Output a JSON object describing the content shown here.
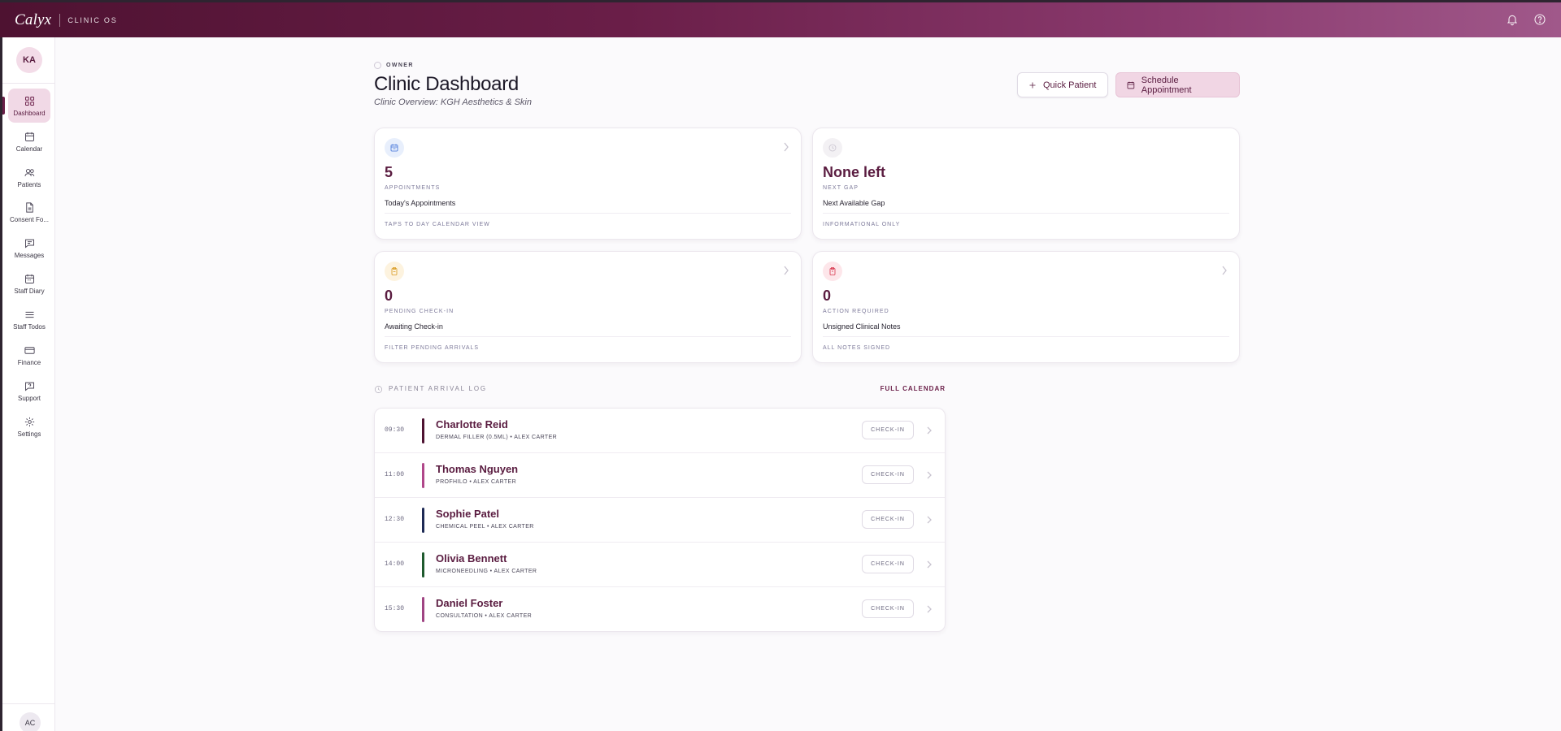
{
  "topbar": {
    "brand": "Calyx",
    "product": "CLINIC OS",
    "icons": [
      "bell-icon",
      "help-icon"
    ]
  },
  "sidebar": {
    "user_initials": "KA",
    "footer_initials": "AC",
    "items": [
      {
        "label": "Dashboard",
        "icon": "grid-icon",
        "active": true
      },
      {
        "label": "Calendar",
        "icon": "calendar-icon",
        "active": false
      },
      {
        "label": "Patients",
        "icon": "users-icon",
        "active": false
      },
      {
        "label": "Consent Fo...",
        "icon": "document-icon",
        "active": false
      },
      {
        "label": "Messages",
        "icon": "message-icon",
        "active": false
      },
      {
        "label": "Staff Diary",
        "icon": "diary-icon",
        "active": false
      },
      {
        "label": "Staff Todos",
        "icon": "list-icon",
        "active": false
      },
      {
        "label": "Finance",
        "icon": "card-icon",
        "active": false
      },
      {
        "label": "Support",
        "icon": "support-icon",
        "active": false
      },
      {
        "label": "Settings",
        "icon": "gear-icon",
        "active": false
      }
    ]
  },
  "header": {
    "role": "OWNER",
    "title": "Clinic Dashboard",
    "subtitle": "Clinic Overview: KGH Aesthetics & Skin",
    "quick_patient": "Quick Patient",
    "schedule": "Schedule Appointment"
  },
  "cards": [
    {
      "value": "5",
      "caption": "APPOINTMENTS",
      "description": "Today's Appointments",
      "footer": "TAPS TO DAY CALENDAR VIEW",
      "icon": "calendar-icon",
      "accent": "#3b6fd8"
    },
    {
      "value": "None left",
      "caption": "NEXT GAP",
      "description": "Next Available Gap",
      "footer": "INFORMATIONAL ONLY",
      "icon": "clock-icon",
      "accent": "#c9c4cf"
    },
    {
      "value": "0",
      "caption": "PENDING CHECK-IN",
      "description": "Awaiting Check-in",
      "footer": "FILTER PENDING ARRIVALS",
      "icon": "clipboard-icon",
      "accent": "#d99a1e"
    },
    {
      "value": "0",
      "caption": "ACTION REQUIRED",
      "description": "Unsigned Clinical Notes",
      "footer": "ALL NOTES SIGNED",
      "icon": "clipboard-alert-icon",
      "accent": "#d6334a"
    }
  ],
  "log": {
    "title": "PATIENT ARRIVAL LOG",
    "full_calendar": "FULL CALENDAR",
    "checkin_label": "CHECK-IN",
    "rows": [
      {
        "time": "09:30",
        "name": "Charlotte Reid",
        "meta": "DERMAL FILLER (0.5ML) • ALEX CARTER",
        "color": "#4e1231"
      },
      {
        "time": "11:00",
        "name": "Thomas Nguyen",
        "meta": "PROFHILO • ALEX CARTER",
        "color": "#b0478a"
      },
      {
        "time": "12:30",
        "name": "Sophie Patel",
        "meta": "CHEMICAL PEEL • ALEX CARTER",
        "color": "#1e2a55"
      },
      {
        "time": "14:00",
        "name": "Olivia Bennett",
        "meta": "MICRONEEDLING • ALEX CARTER",
        "color": "#1f5a2e"
      },
      {
        "time": "15:30",
        "name": "Daniel Foster",
        "meta": "CONSULTATION • ALEX CARTER",
        "color": "#a04483"
      }
    ]
  }
}
